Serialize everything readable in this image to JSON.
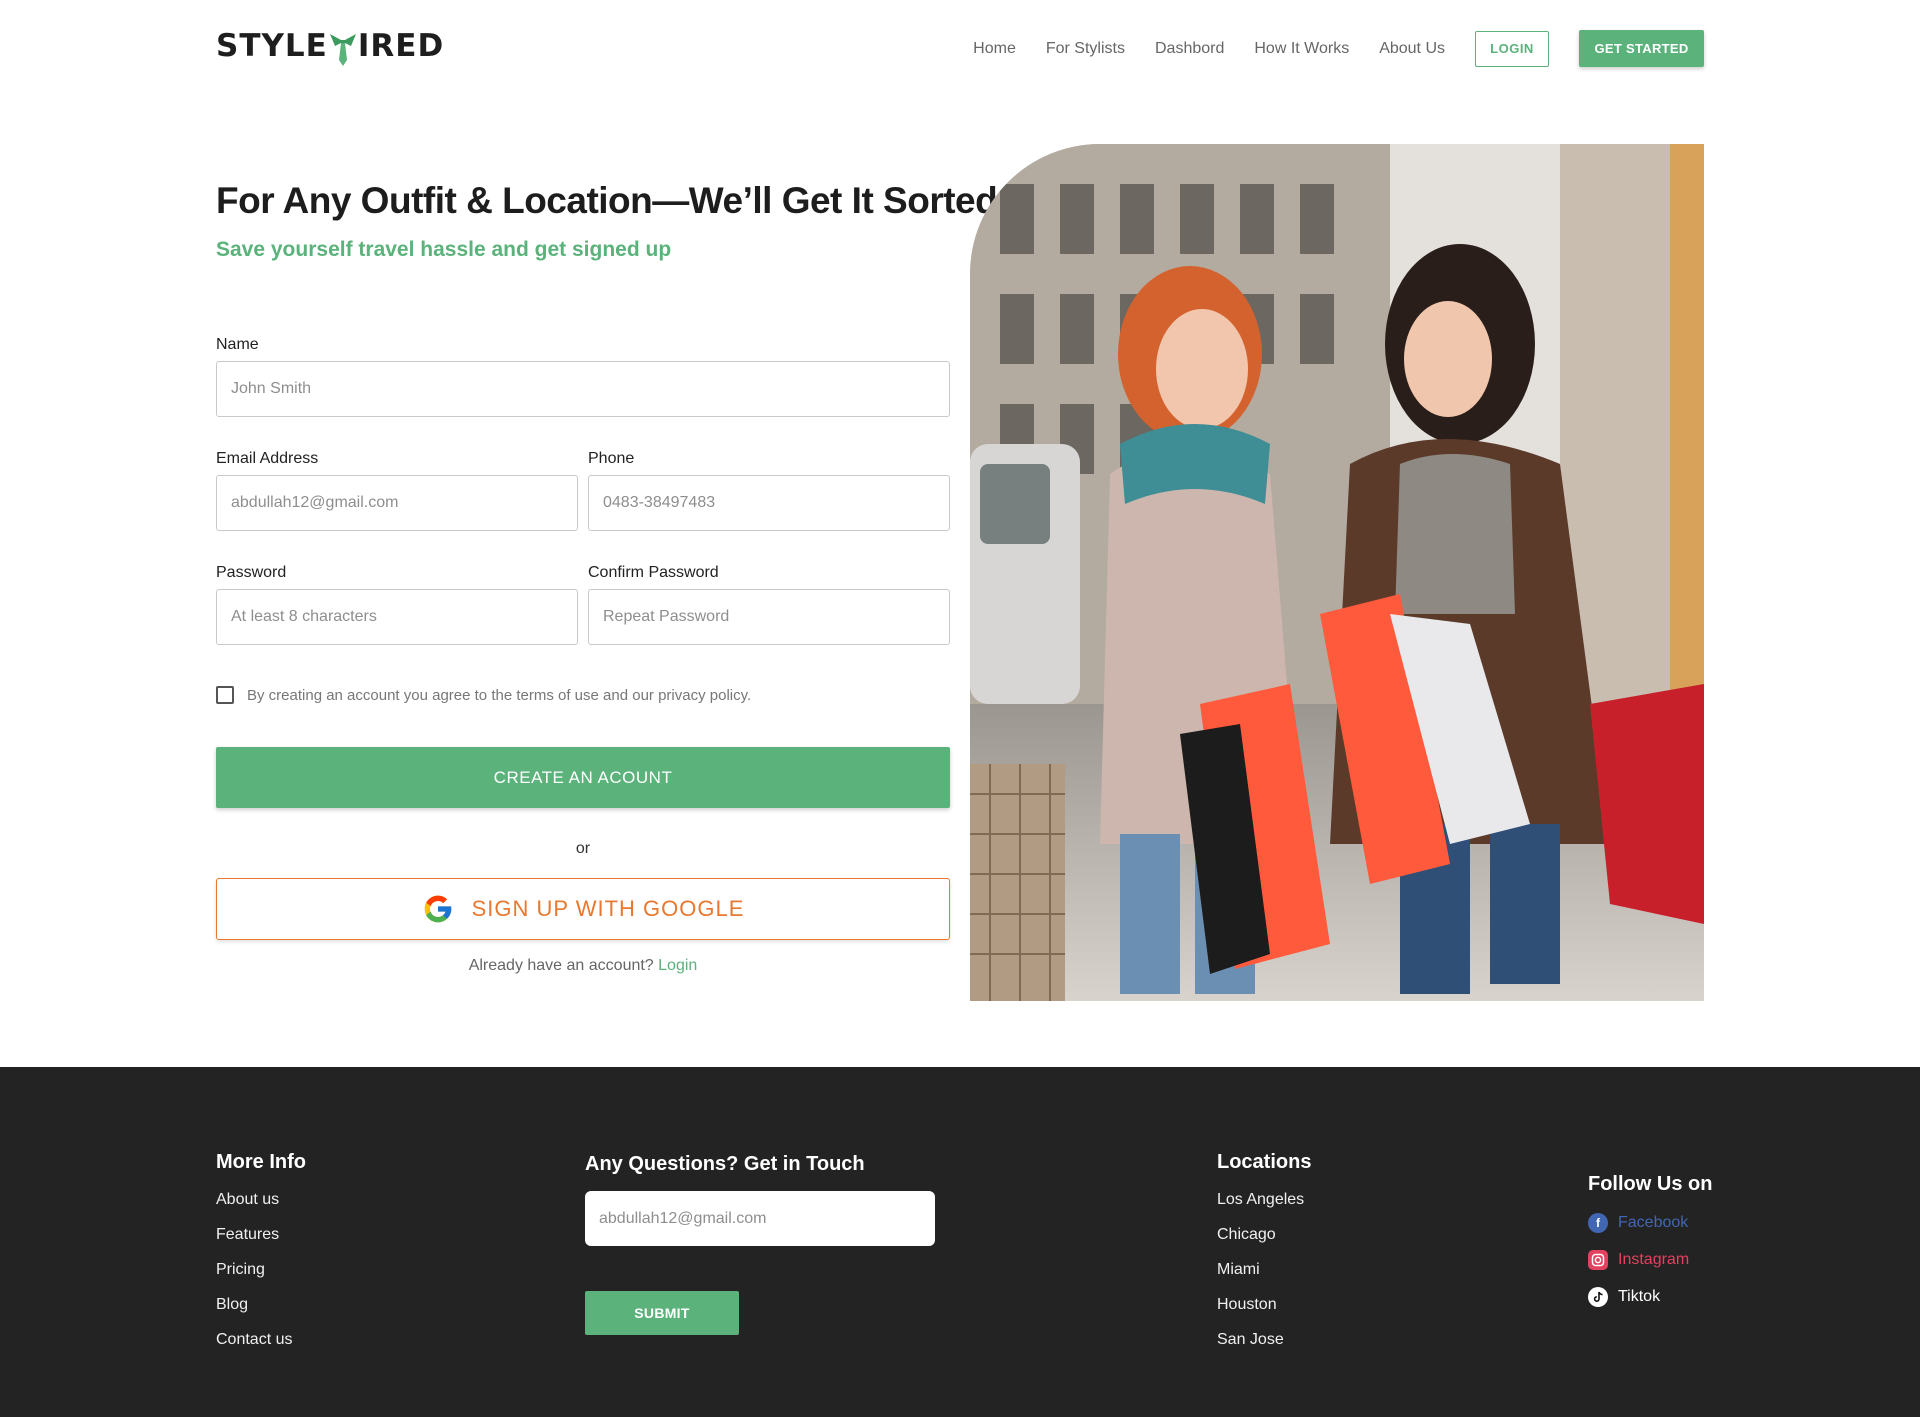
{
  "header": {
    "brand_left": "STYLE",
    "brand_right": "IRED",
    "nav": [
      "Home",
      "For Stylists",
      "Dashbord",
      "How It Works",
      "About Us"
    ],
    "login_label": "LOGIN",
    "get_started_label": "GET STARTED"
  },
  "hero": {
    "title": "For Any Outfit & Location—We’ll Get It Sorted",
    "subtitle": "Save yourself travel hassle and get signed up"
  },
  "form": {
    "name_label": "Name",
    "name_placeholder": "John Smith",
    "email_label": "Email Address",
    "email_placeholder": "abdullah12@gmail.com",
    "phone_label": "Phone",
    "phone_placeholder": "0483-38497483",
    "password_label": "Password",
    "password_placeholder": "At least 8 characters",
    "confirm_label": "Confirm Password",
    "confirm_placeholder": "Repeat Password",
    "terms_text": "By creating an account you agree to the terms of use and our privacy policy.",
    "create_label": "CREATE AN ACOUNT",
    "or_text": "or",
    "google_label": "SIGN UP WITH GOOGLE",
    "already_text": "Already have an account? ",
    "login_link": "Login"
  },
  "footer": {
    "more_info_heading": "More Info",
    "more_info_links": [
      "About us",
      "Features",
      "Pricing",
      "Blog",
      "Contact us"
    ],
    "contact_heading": "Any Questions? Get in Touch",
    "contact_placeholder": "abdullah12@gmail.com",
    "submit_label": "SUBMIT",
    "locations_heading": "Locations",
    "locations": [
      "Los Angeles",
      "Chicago",
      "Miami",
      "Houston",
      "San Jose"
    ],
    "follow_heading": "Follow Us on",
    "socials": [
      {
        "label": "Facebook",
        "icon": "facebook-icon",
        "color": "#4267b2"
      },
      {
        "label": "Instagram",
        "icon": "instagram-icon",
        "color": "#e4405f"
      },
      {
        "label": "Tiktok",
        "icon": "tiktok-icon",
        "color": "#ffffff"
      }
    ]
  },
  "colors": {
    "accent_green": "#5bb27b",
    "google_orange": "#e8782f",
    "footer_bg": "#232323"
  }
}
